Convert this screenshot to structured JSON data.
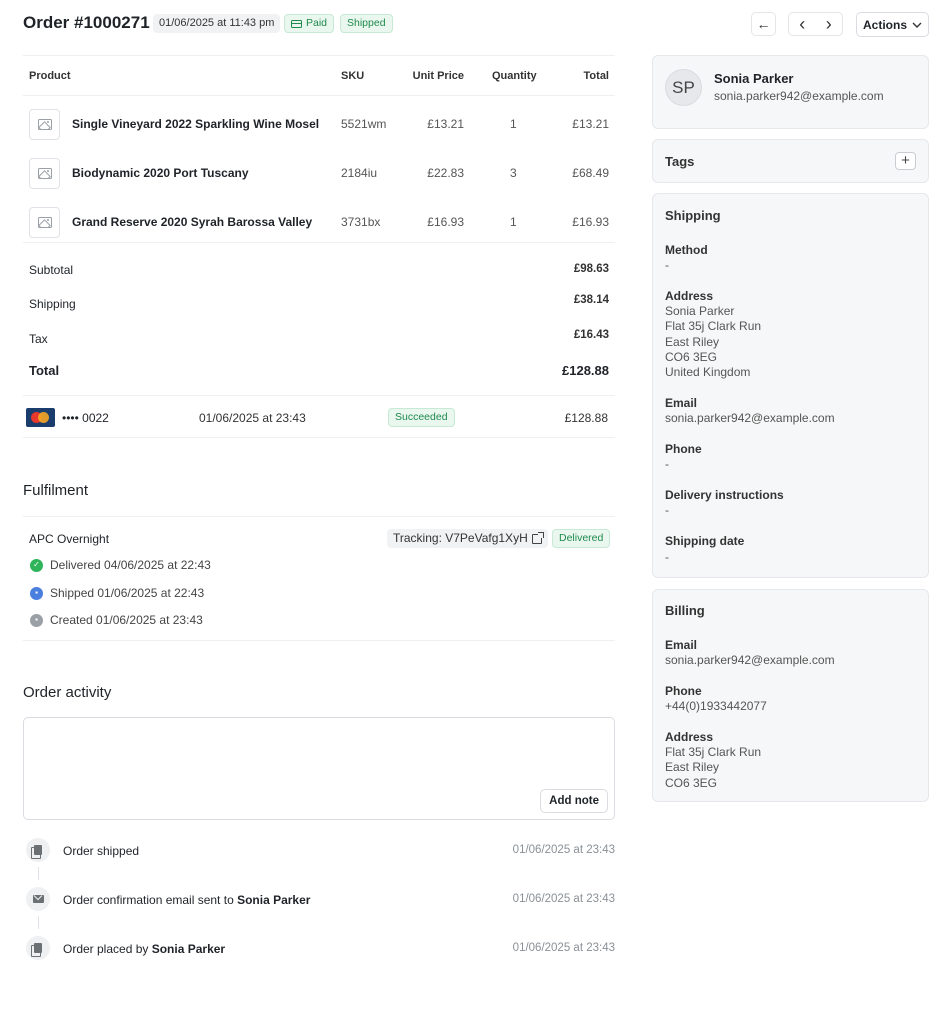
{
  "header": {
    "title": "Order #1000271",
    "date": "01/06/2025 at 11:43 pm",
    "badges": {
      "paid": "Paid",
      "shipped": "Shipped"
    },
    "back_icon": "←",
    "prev_icon": "‹",
    "next_icon": "›",
    "actions_label": "Actions"
  },
  "items_table": {
    "columns": {
      "product": "Product",
      "sku": "SKU",
      "unit_price": "Unit Price",
      "quantity": "Quantity",
      "total": "Total"
    },
    "rows": [
      {
        "name": "Single Vineyard 2022 Sparkling Wine Mosel",
        "sku": "5521wm",
        "unit_price": "£13.21",
        "quantity": "1",
        "total": "£13.21"
      },
      {
        "name": "Biodynamic 2020 Port Tuscany",
        "sku": "2184iu",
        "unit_price": "£22.83",
        "quantity": "3",
        "total": "£68.49"
      },
      {
        "name": "Grand Reserve 2020 Syrah Barossa Valley",
        "sku": "3731bx",
        "unit_price": "£16.93",
        "quantity": "1",
        "total": "£16.93"
      }
    ]
  },
  "summary": {
    "subtotal_label": "Subtotal",
    "subtotal": "£98.63",
    "shipping_label": "Shipping",
    "shipping": "£38.14",
    "tax_label": "Tax",
    "tax": "£16.43",
    "total_label": "Total",
    "total": "£128.88"
  },
  "payment": {
    "card": "•••• 0022",
    "date": "01/06/2025 at 23:43",
    "status": "Succeeded",
    "amount": "£128.88"
  },
  "fulfilment": {
    "title": "Fulfilment",
    "carrier": "APC Overnight",
    "tracking": "Tracking: V7PeVafg1XyH",
    "status": "Delivered",
    "events": [
      {
        "text": "Delivered 04/06/2025 at 22:43",
        "icon": "check-icon"
      },
      {
        "text": "Shipped 01/06/2025 at 22:43",
        "icon": "truck-icon"
      },
      {
        "text": "Created 01/06/2025 at 23:43",
        "icon": "box-icon"
      }
    ]
  },
  "activity": {
    "title": "Order activity",
    "add_note_label": "Add note",
    "items": [
      {
        "text": "Order shipped",
        "person": "",
        "time": "01/06/2025 at 23:43"
      },
      {
        "text": "Order confirmation email sent to ",
        "person": "Sonia Parker",
        "time": "01/06/2025 at 23:43"
      },
      {
        "text": "Order placed by ",
        "person": "Sonia Parker",
        "time": "01/06/2025 at 23:43"
      }
    ]
  },
  "customer": {
    "initials": "SP",
    "name": "Sonia Parker",
    "email": "sonia.parker942@example.com"
  },
  "tags": {
    "title": "Tags",
    "add_icon": "+"
  },
  "shipping": {
    "title": "Shipping",
    "method_label": "Method",
    "method": "-",
    "address_label": "Address",
    "address": [
      "Sonia Parker",
      "Flat 35j Clark Run",
      "East Riley",
      "CO6 3EG",
      "United Kingdom"
    ],
    "email_label": "Email",
    "email": "sonia.parker942@example.com",
    "phone_label": "Phone",
    "phone": "-",
    "instructions_label": "Delivery instructions",
    "instructions": "-",
    "date_label": "Shipping date",
    "date": "-"
  },
  "billing": {
    "title": "Billing",
    "email_label": "Email",
    "email": "sonia.parker942@example.com",
    "phone_label": "Phone",
    "phone": "+44(0)1933442077",
    "address_label": "Address",
    "address": [
      "Flat 35j Clark Run",
      "East Riley",
      "CO6 3EG"
    ]
  },
  "colors": {
    "success_text": "#1f8a4c",
    "success_bg": "#eaf7ef",
    "panel_bg": "#f6f7f8"
  }
}
